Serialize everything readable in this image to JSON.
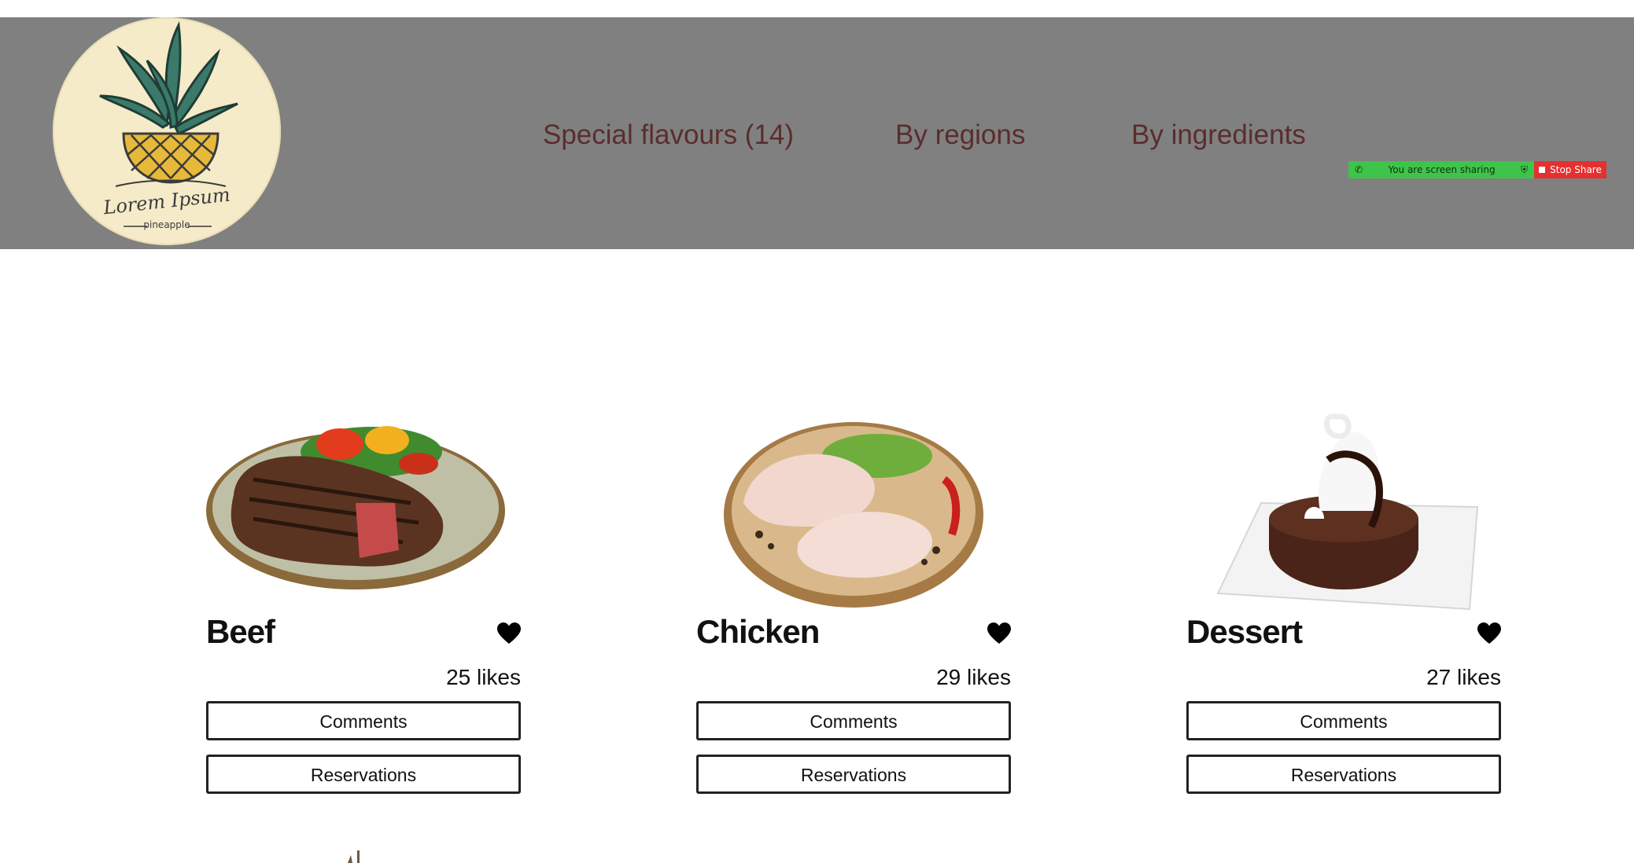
{
  "header": {
    "logo": {
      "title": "Lorem Ipsum",
      "subtitle": "pineapple",
      "icon": "pineapple-logo-icon"
    },
    "nav": [
      {
        "label": "Special flavours (14)"
      },
      {
        "label": "By regions"
      },
      {
        "label": "By ingredients"
      }
    ]
  },
  "screen_share": {
    "status_text": "You are screen sharing",
    "stop_label": "Stop Share",
    "status_color": "#3ec44a",
    "stop_color": "#e53030"
  },
  "cards": [
    {
      "title": "Beef",
      "likes": "25 likes",
      "comments_label": "Comments",
      "reservations_label": "Reservations",
      "image_icon": "steak-plate-image"
    },
    {
      "title": "Chicken",
      "likes": "29 likes",
      "comments_label": "Comments",
      "reservations_label": "Reservations",
      "image_icon": "raw-chicken-plate-image"
    },
    {
      "title": "Dessert",
      "likes": "27 likes",
      "comments_label": "Comments",
      "reservations_label": "Reservations",
      "image_icon": "chocolate-cake-plate-image"
    }
  ],
  "colors": {
    "header_bg": "#808080",
    "nav_text": "#5a2d2d",
    "logo_bg": "#f5ebc9"
  }
}
